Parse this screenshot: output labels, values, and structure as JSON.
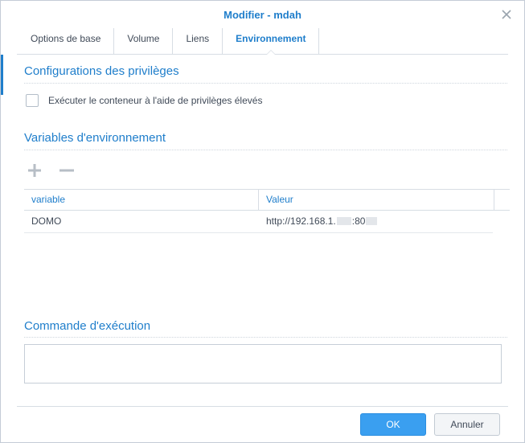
{
  "dialog": {
    "title": "Modifier - mdah"
  },
  "tabs": [
    {
      "label": "Options de base"
    },
    {
      "label": "Volume"
    },
    {
      "label": "Liens"
    },
    {
      "label": "Environnement",
      "active": true
    }
  ],
  "privileges": {
    "title": "Configurations des privilèges",
    "checkbox_label": "Exécuter le conteneur à l'aide de privilèges élevés",
    "checked": false
  },
  "env": {
    "title": "Variables d'environnement",
    "toolbar": {
      "add_icon": "plus-icon",
      "remove_icon": "minus-icon"
    },
    "columns": [
      "variable",
      "Valeur"
    ],
    "rows": [
      {
        "variable": "DOMO",
        "value_prefix": "http://192.168.1.",
        "value_mid": ":80"
      }
    ]
  },
  "command": {
    "title": "Commande d'exécution",
    "value": ""
  },
  "footer": {
    "ok_label": "OK",
    "cancel_label": "Annuler"
  },
  "colors": {
    "accent": "#1f7ecb",
    "ok_button": "#3a9ff0",
    "text": "#404a58"
  }
}
